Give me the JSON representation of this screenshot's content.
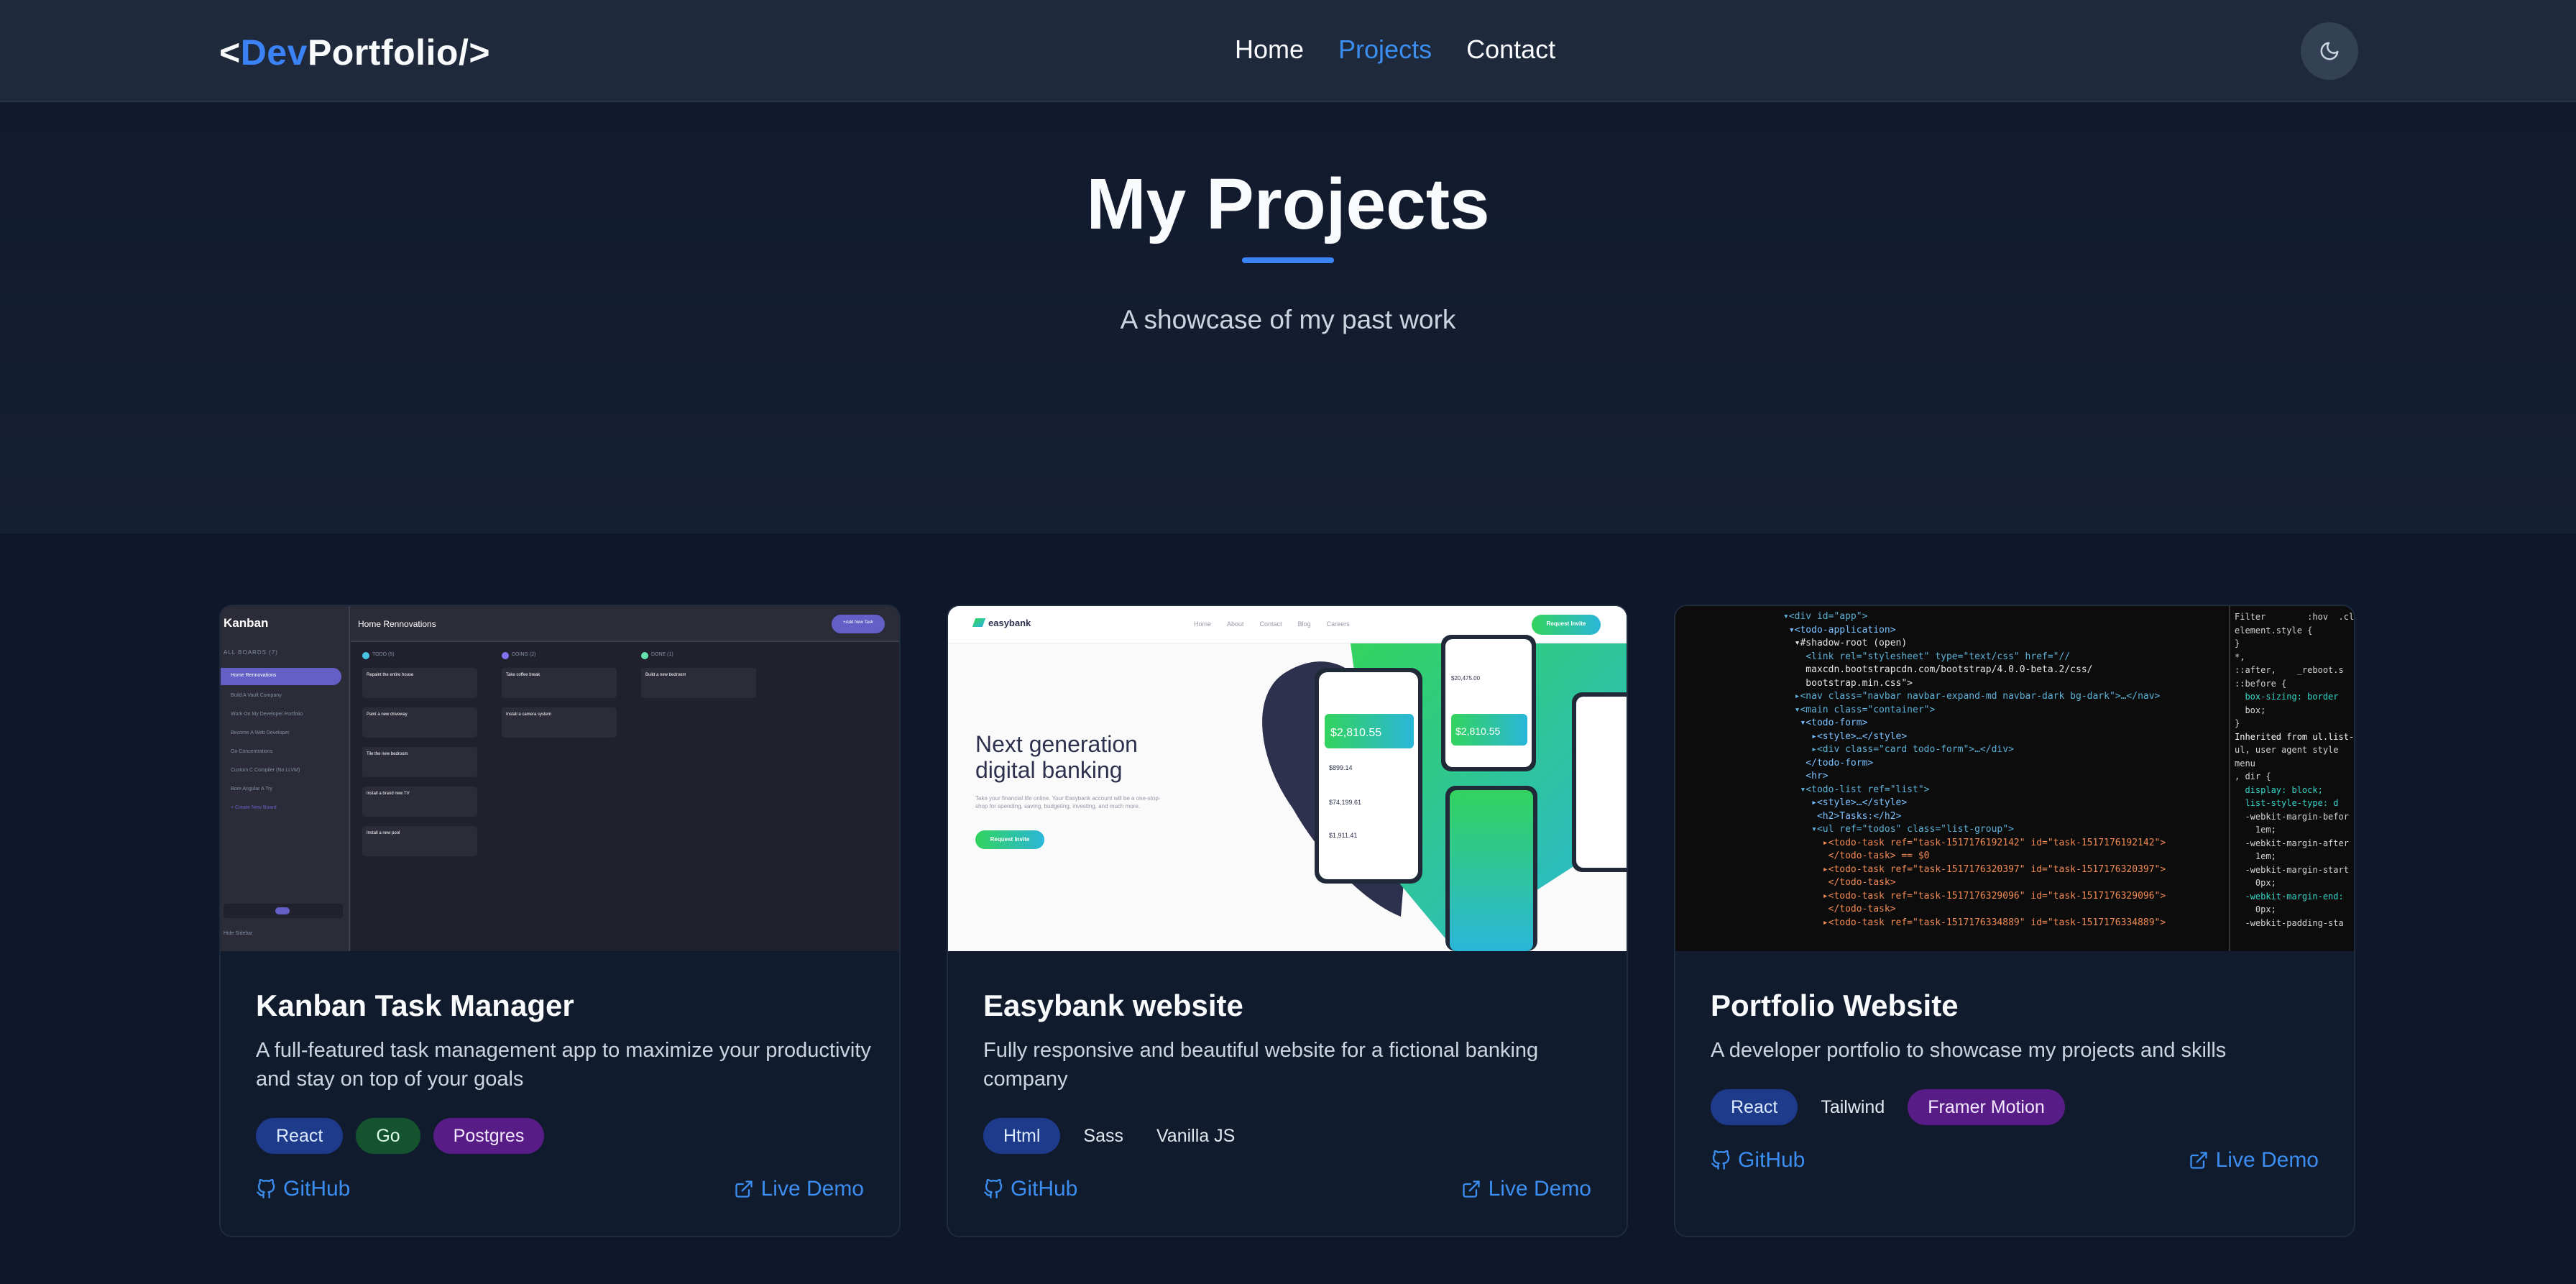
{
  "nav": {
    "logo_open": "<",
    "logo_dev": "Dev",
    "logo_rest": "Portfolio/>",
    "links": [
      {
        "label": "Home",
        "active": false
      },
      {
        "label": "Projects",
        "active": true
      },
      {
        "label": "Contact",
        "active": false
      }
    ],
    "theme_icon": "moon-icon"
  },
  "hero": {
    "title": "My Projects",
    "subtitle": "A showcase of my past work"
  },
  "projects": [
    {
      "title": "Kanban Task Manager",
      "description": "A full-featured task management app to maximize your productivity and stay on top of your goals",
      "tags": [
        {
          "label": "React",
          "style": "blue"
        },
        {
          "label": "Go",
          "style": "green"
        },
        {
          "label": "Postgres",
          "style": "purple"
        }
      ],
      "github_label": "GitHub",
      "demo_label": "Live Demo",
      "preview": {
        "app_name": "Kanban",
        "board_title": "Home Rennovations",
        "add_task": "+Add New Task",
        "boards_heading": "ALL BOARDS (7)",
        "boards": [
          "Home Rennovations",
          "Build A Vault Company",
          "Work On My Developer Portfolio",
          "Become A Web Developer",
          "Go Concentrations",
          "Custom C Compiler (No LLVM)",
          "Bore Angular A Try"
        ],
        "create_board": "+ Create New Board",
        "hide_sidebar": "Hide Sidebar",
        "columns": [
          {
            "name": "TODO (5)",
            "color": "#49c4e5",
            "cards": [
              "Repaint the entire house",
              "Paint a new driveway",
              "Tile the new bedroom",
              "Install a brand new TV",
              "Install a new pool"
            ]
          },
          {
            "name": "DOING (2)",
            "color": "#8471f2",
            "cards": [
              "Take coffee break",
              "Install a camera system"
            ]
          },
          {
            "name": "DONE (1)",
            "color": "#67e2ae",
            "cards": [
              "Build a new bedroom"
            ]
          }
        ],
        "card_sub": "0 of 3 subtasks completed"
      }
    },
    {
      "title": "Easybank website",
      "description": "Fully responsive and beautiful website for a fictional banking company",
      "tags": [
        {
          "label": "Html",
          "style": "blue"
        },
        {
          "label": "Sass",
          "style": "plain"
        },
        {
          "label": "Vanilla JS",
          "style": "plain"
        }
      ],
      "github_label": "GitHub",
      "demo_label": "Live Demo",
      "preview": {
        "brand": "easybank",
        "menu": [
          "Home",
          "About",
          "Contact",
          "Blog",
          "Careers"
        ],
        "cta": "Request Invite",
        "headline_1": "Next generation",
        "headline_2": "digital banking",
        "body": "Take your financial life online. Your Easybank account will be a one-stop-shop for spending, saving, budgeting, investing, and much more.",
        "balance": "$2,810.55",
        "amounts": [
          "$899.14",
          "$74,199.61",
          "$1,911.41",
          "$20,475.00"
        ]
      }
    },
    {
      "title": "Portfolio Website",
      "description": "A developer portfolio to showcase my projects and skills",
      "tags": [
        {
          "label": "React",
          "style": "blue"
        },
        {
          "label": "Tailwind",
          "style": "plain"
        },
        {
          "label": "Framer Motion",
          "style": "purple"
        }
      ],
      "github_label": "GitHub",
      "demo_label": "Live Demo",
      "preview": {
        "code_lines": [
          "▾<div id=\"app\">",
          " ▾<todo-application>",
          "  ▾#shadow-root (open)",
          "    <link rel=\"stylesheet\" type=\"text/css\" href=\"//",
          "    maxcdn.bootstrapcdn.com/bootstrap/4.0.0-beta.2/css/",
          "    bootstrap.min.css\">",
          "  ▸<nav class=\"navbar navbar-expand-md navbar-dark bg-dark\">…</nav>",
          "  ▾<main class=\"container\">",
          "   ▾<todo-form>",
          "     ▸<style>…</style>",
          "     ▸<div class=\"card todo-form\">…</div>",
          "    </todo-form>",
          "    <hr>",
          "   ▾<todo-list ref=\"list\">",
          "     ▸<style>…</style>",
          "      <h2>Tasks:</h2>",
          "     ▾<ul ref=\"todos\" class=\"list-group\">",
          "       ▸<todo-task ref=\"task-1517176192142\" id=\"task-1517176192142\">",
          "        </todo-task> == $0",
          "       ▸<todo-task ref=\"task-1517176320397\" id=\"task-1517176320397\">",
          "        </todo-task>",
          "       ▸<todo-task ref=\"task-1517176329096\" id=\"task-1517176329096\">",
          "        </todo-task>",
          "       ▸<todo-task ref=\"task-1517176334889\" id=\"task-1517176334889\">"
        ],
        "side_lines": [
          "Filter        :hov  .cl",
          "element.style {",
          "}",
          "*,",
          "::after,    _reboot.s",
          "::before {",
          "  box-sizing: border",
          "  box;",
          "}",
          "Inherited from ul.list-",
          "ul, user agent style",
          "menu",
          ", dir {",
          "  display: block;",
          "  list-style-type: d",
          "  -webkit-margin-befor",
          "    1em;",
          "  -webkit-margin-after",
          "    1em;",
          "  -webkit-margin-start",
          "    0px;",
          "  -webkit-margin-end:",
          "    0px;",
          "  -webkit-padding-sta"
        ]
      }
    }
  ]
}
